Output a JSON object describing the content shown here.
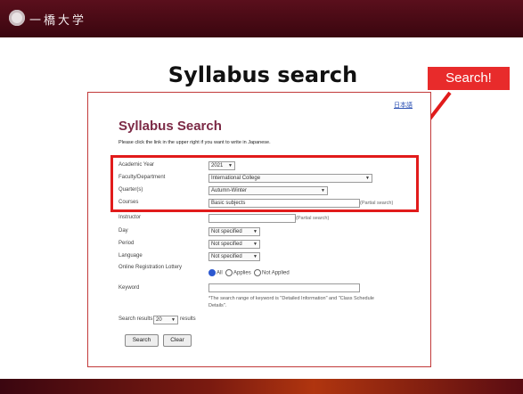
{
  "header": {
    "logo_text": "一橋大学"
  },
  "slide": {
    "title": "Syllabus search",
    "callout": "Search!",
    "accent": "#e11b1b"
  },
  "screenshot": {
    "lang_link": "日本語",
    "heading": "Syllabus Search",
    "note": "Please click the link in the upper right if you want to write in Japanese.",
    "fields": [
      {
        "label": "Academic Year",
        "value": "2021"
      },
      {
        "label": "Faculty/Department",
        "value": "International College"
      },
      {
        "label": "Quarter(s)",
        "value": "Autumn-Winter"
      },
      {
        "label": "Courses",
        "value": "Basic subjects"
      },
      {
        "label": "Instructor",
        "value": ""
      },
      {
        "label": "Day",
        "value": "Not specified"
      },
      {
        "label": "Period",
        "value": "Not specified"
      },
      {
        "label": "Language",
        "value": "Not specified"
      },
      {
        "label": "Online Registration Lottery",
        "value": ""
      },
      {
        "label": "Keyword",
        "value": ""
      }
    ],
    "partial_search_1": "(Partial search)",
    "partial_search_2": "(Partial search)",
    "radio_all": "All",
    "radio_applies": "Applies",
    "radio_not_applies": "Not Applied",
    "keyword_note": "*The search range of keyword is \"Detailed Information\" and \"Class Schedule Details\".",
    "results_label": "Search results",
    "results_count": "20",
    "results_suffix": "results",
    "search_button": "Search",
    "clear_button": "Clear"
  }
}
